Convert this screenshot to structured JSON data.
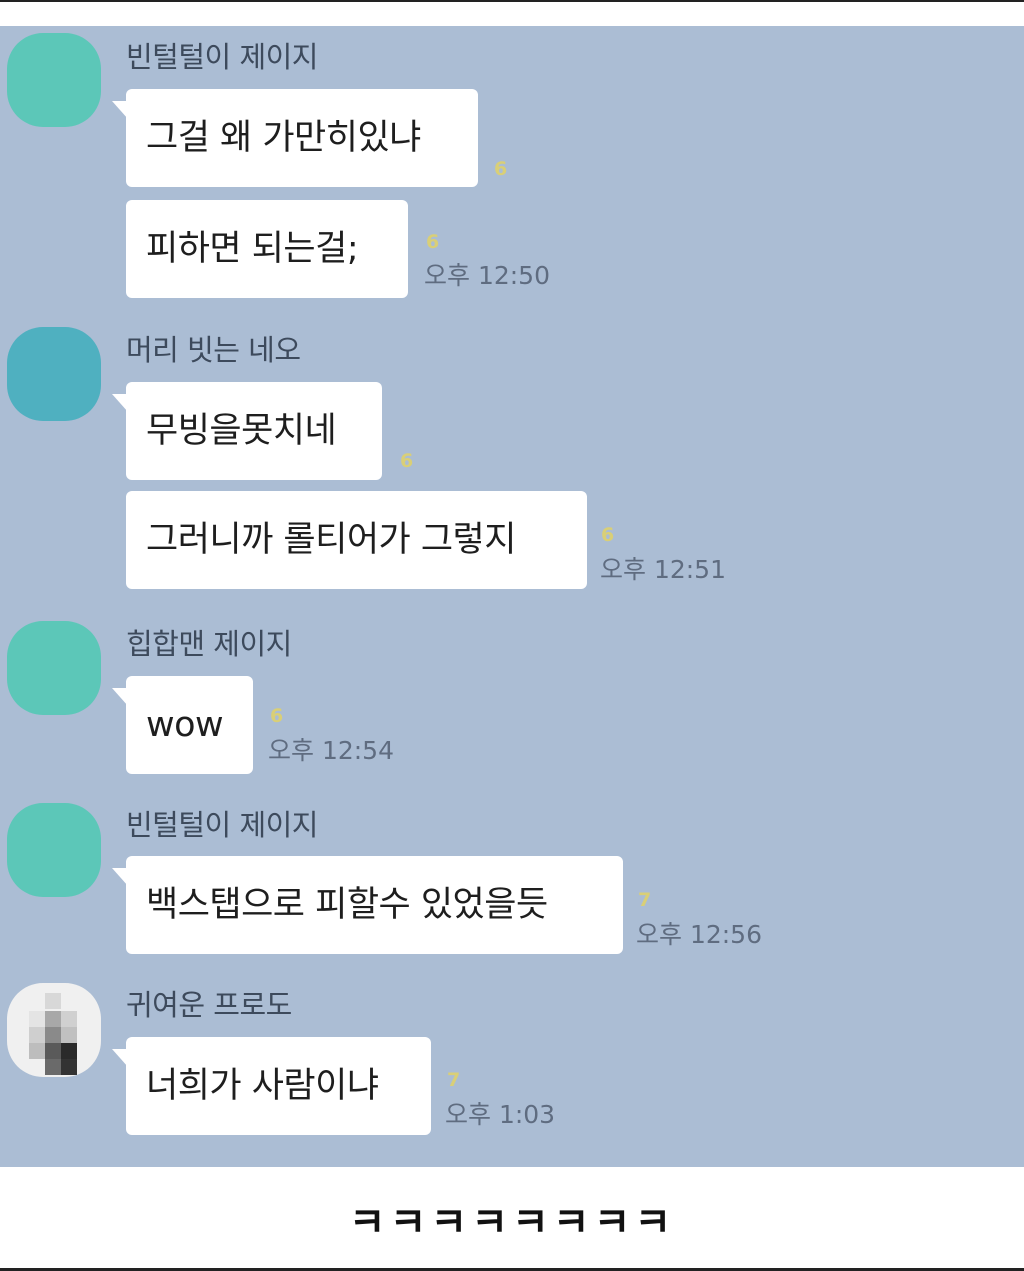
{
  "chat": {
    "colors": {
      "background": "#abbdd4",
      "bubble": "#ffffff",
      "avatar_teal": "#5cc7b8",
      "avatar_blue": "#4fb0c0",
      "unread": "#d9cf77"
    },
    "groups": [
      {
        "sender": "빈털털이 제이지",
        "messages": [
          {
            "text": "그걸 왜 가만히있냐",
            "unread": "6",
            "time": ""
          },
          {
            "text": "피하면 되는걸;",
            "unread": "6",
            "time": "오후 12:50"
          }
        ]
      },
      {
        "sender": "머리 빗는 네오",
        "messages": [
          {
            "text": "무빙을못치네",
            "unread": "6",
            "time": ""
          },
          {
            "text": "그러니까 롤티어가 그렇지",
            "unread": "6",
            "time": "오후 12:51"
          }
        ]
      },
      {
        "sender": "힙합맨 제이지",
        "messages": [
          {
            "text": "wow",
            "unread": "6",
            "time": "오후 12:54"
          }
        ]
      },
      {
        "sender": "빈털털이 제이지",
        "messages": [
          {
            "text": "백스탭으로 피할수 있었을듯",
            "unread": "7",
            "time": "오후 12:56"
          }
        ]
      },
      {
        "sender": "귀여운 프로도",
        "messages": [
          {
            "text": "너희가 사람이냐",
            "unread": "7",
            "time": "오후 1:03"
          }
        ]
      }
    ]
  },
  "caption": "ㅋㅋㅋㅋㅋㅋㅋㅋ"
}
